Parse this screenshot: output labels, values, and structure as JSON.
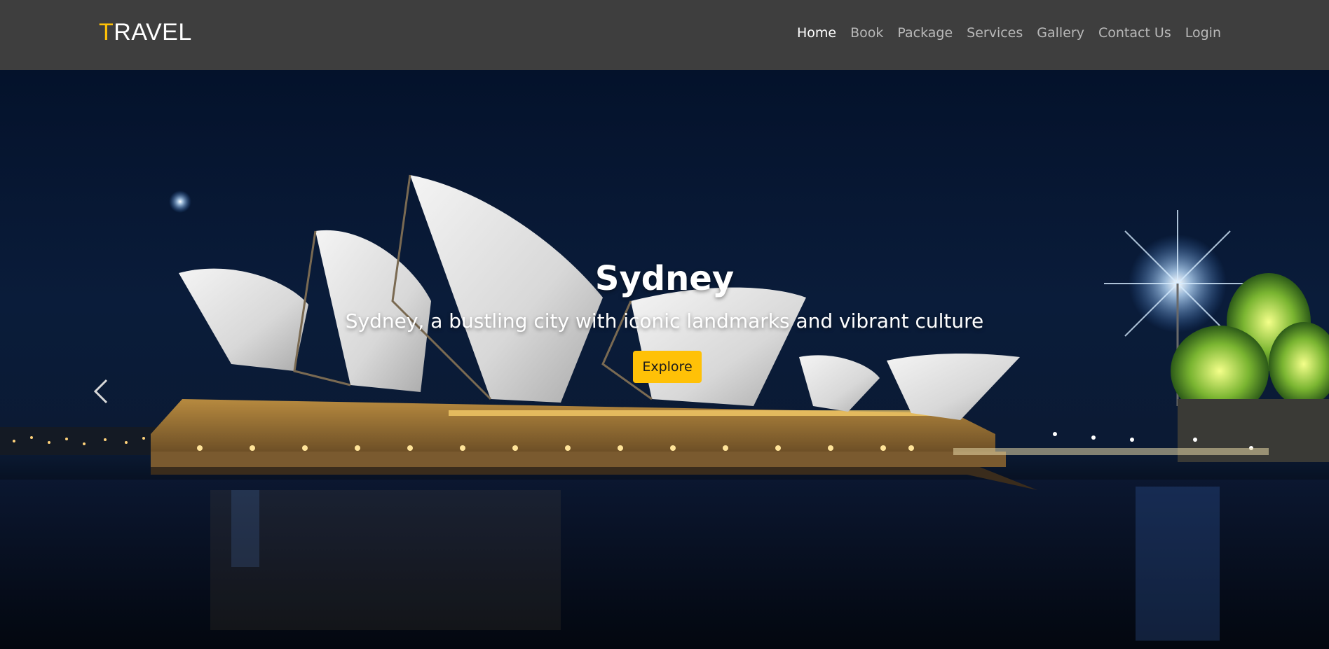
{
  "brand": {
    "first_letter": "T",
    "rest": "RAVEL",
    "accent_color": "#ffc107"
  },
  "nav": {
    "items": [
      {
        "label": "Home",
        "active": true
      },
      {
        "label": "Book"
      },
      {
        "label": "Package"
      },
      {
        "label": "Services"
      },
      {
        "label": "Gallery"
      },
      {
        "label": "Contact Us"
      },
      {
        "label": "Login"
      }
    ]
  },
  "hero": {
    "title": "Sydney",
    "subtitle": "Sydney, a bustling city with iconic landmarks and vibrant culture",
    "button_label": "Explore",
    "prev_icon": "chevron-left-icon"
  },
  "colors": {
    "navbar_bg": "#3e3e3e",
    "button_bg": "#ffc107",
    "nav_active": "#ffffff",
    "nav_inactive": "#b9b9b9"
  }
}
